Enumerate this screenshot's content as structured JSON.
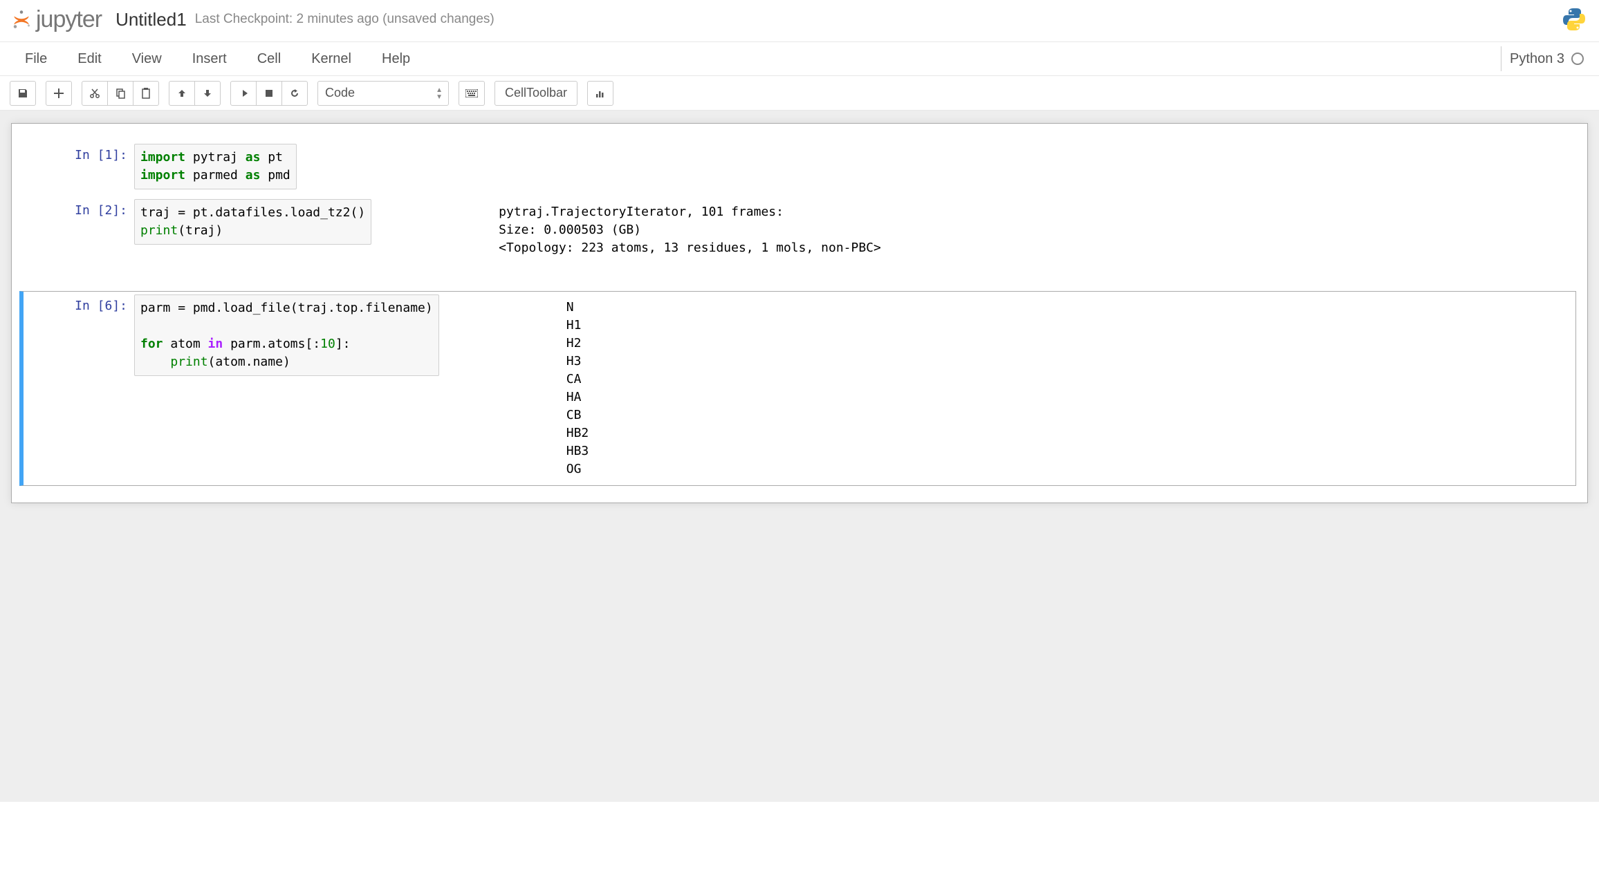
{
  "header": {
    "logo_text": "jupyter",
    "title": "Untitled1",
    "checkpoint": "Last Checkpoint: 2 minutes ago (unsaved changes)"
  },
  "menubar": {
    "items": [
      "File",
      "Edit",
      "View",
      "Insert",
      "Cell",
      "Kernel",
      "Help"
    ],
    "kernel_name": "Python 3"
  },
  "toolbar": {
    "cell_type": "Code",
    "celltoolbar_label": "CellToolbar"
  },
  "cells": [
    {
      "prompt": "In [1]:",
      "code_lines": [
        [
          {
            "t": "import",
            "c": "k-kw"
          },
          {
            "t": " pytraj "
          },
          {
            "t": "as",
            "c": "k-kw"
          },
          {
            "t": " pt"
          }
        ],
        [
          {
            "t": "import",
            "c": "k-kw"
          },
          {
            "t": " parmed "
          },
          {
            "t": "as",
            "c": "k-kw"
          },
          {
            "t": " pmd"
          }
        ]
      ],
      "output": ""
    },
    {
      "prompt": "In [2]:",
      "code_lines": [
        [
          {
            "t": "traj "
          },
          {
            "t": "="
          },
          {
            "t": " pt"
          },
          {
            "t": "."
          },
          {
            "t": "datafiles"
          },
          {
            "t": "."
          },
          {
            "t": "load_tz2"
          },
          {
            "t": "()"
          }
        ],
        [
          {
            "t": "print",
            "c": "k-builtin"
          },
          {
            "t": "("
          },
          {
            "t": "traj"
          },
          {
            "t": ")"
          }
        ]
      ],
      "output": "pytraj.TrajectoryIterator, 101 frames: \nSize: 0.000503 (GB)\n<Topology: 223 atoms, 13 residues, 1 mols, non-PBC>\n"
    },
    {
      "prompt": "In [6]:",
      "selected": true,
      "code_lines": [
        [
          {
            "t": "parm "
          },
          {
            "t": "="
          },
          {
            "t": " pmd"
          },
          {
            "t": "."
          },
          {
            "t": "load_file"
          },
          {
            "t": "("
          },
          {
            "t": "traj"
          },
          {
            "t": "."
          },
          {
            "t": "top"
          },
          {
            "t": "."
          },
          {
            "t": "filename"
          },
          {
            "t": ")"
          }
        ],
        [],
        [
          {
            "t": "for",
            "c": "k-kw"
          },
          {
            "t": " atom "
          },
          {
            "t": "in",
            "c": "k-op"
          },
          {
            "t": " parm"
          },
          {
            "t": "."
          },
          {
            "t": "atoms"
          },
          {
            "t": "["
          },
          {
            "t": ":"
          },
          {
            "t": "10",
            "c": "k-num"
          },
          {
            "t": "]"
          },
          {
            "t": ":"
          }
        ],
        [
          {
            "t": "    "
          },
          {
            "t": "print",
            "c": "k-builtin"
          },
          {
            "t": "("
          },
          {
            "t": "atom"
          },
          {
            "t": "."
          },
          {
            "t": "name"
          },
          {
            "t": ")"
          }
        ]
      ],
      "output": "N\nH1\nH2\nH3\nCA\nHA\nCB\nHB2\nHB3\nOG"
    }
  ]
}
